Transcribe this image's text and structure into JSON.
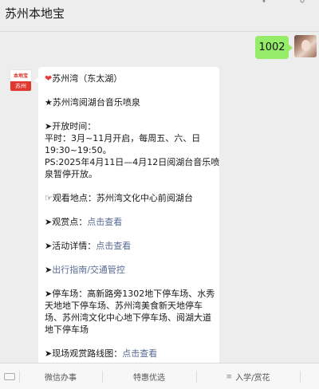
{
  "header": {
    "title": "苏州本地宝",
    "icons": [
      "pin-icon",
      "more-icon"
    ]
  },
  "chat": {
    "user_message": "1002",
    "bot_avatar": {
      "top_text": "本地宝",
      "bottom_text": "苏州"
    },
    "bot_message": {
      "title": "苏州湾（东太湖）",
      "subtitle": "★苏州湾阅湖台音乐喷泉",
      "open_time_label": "➤开放时间：",
      "open_time_line1": "平时：3月~11月开启，每周五、六、日",
      "open_time_line2": "19:30~19:50。",
      "ps_line1": "PS:2025年4月11日—4月12日阅湖台音乐喷",
      "ps_line2": "泉暂停开放。",
      "location": "☞观看地点：苏州湾文化中心前阅湖台",
      "viewing_label": "➤观赏点：",
      "viewing_link": "点击查看",
      "activity_label": "➤活动详情：",
      "activity_link": "点击查看",
      "guide_prefix": "➤",
      "guide_link": "出行指南/交通管控",
      "parking_line1": "➤停车场：高新路旁1302地下停车场、水秀",
      "parking_line2": "天地地下停车场、苏州湾美食新天地停车",
      "parking_line3": "场、苏州湾文化中心地下停车场、阅湖大道",
      "parking_line4": "地下停车场",
      "route_label": "➤现场观赏路线图：",
      "route_link": "点击查看"
    }
  },
  "tabbar": {
    "tab1": "微信办事",
    "tab2": "特惠优选",
    "tab3": "入学/赏花",
    "tab3_icon": "≡"
  },
  "colors": {
    "background": "#ededed",
    "user_bubble": "#95ec69",
    "link": "#576b95",
    "heart": "#e23b3b"
  }
}
